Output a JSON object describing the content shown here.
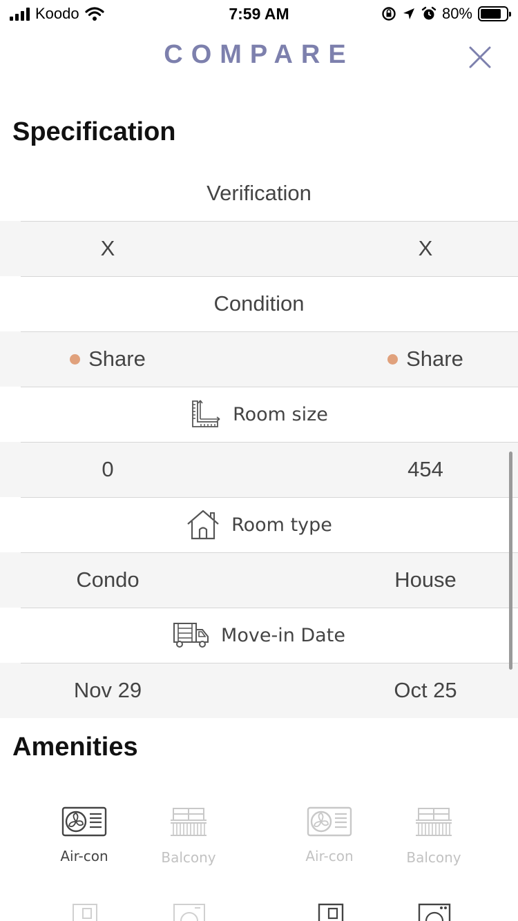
{
  "status_bar": {
    "carrier": "Koodo",
    "time": "7:59 AM",
    "battery": "80%"
  },
  "header": {
    "title": "COMPARE"
  },
  "specification": {
    "title": "Specification",
    "rows": [
      {
        "label": "Verification",
        "left": "X",
        "right": "X"
      },
      {
        "label": "Condition",
        "left": "Share",
        "right": "Share"
      },
      {
        "label": "Room size",
        "icon": "room-size-icon",
        "left": "0",
        "right": "454"
      },
      {
        "label": "Room type",
        "icon": "house-icon",
        "left": "Condo",
        "right": "House"
      },
      {
        "label": "Move-in Date",
        "icon": "moving-truck-icon",
        "left": "Nov 29",
        "right": "Oct 25"
      }
    ]
  },
  "amenities": {
    "title": "Amenities",
    "items": [
      {
        "label": "Air-con",
        "icon": "air-con-icon",
        "active": true
      },
      {
        "label": "Balcony",
        "icon": "balcony-icon",
        "active": false
      },
      {
        "label": "Air-con",
        "icon": "air-con-icon",
        "active": false
      },
      {
        "label": "Balcony",
        "icon": "balcony-icon",
        "active": false
      }
    ]
  },
  "colors": {
    "accent": "#7d80ad",
    "share_dot": "#e0a17c",
    "row_alt": "#f5f5f5",
    "inactive": "#c2c2c2"
  }
}
